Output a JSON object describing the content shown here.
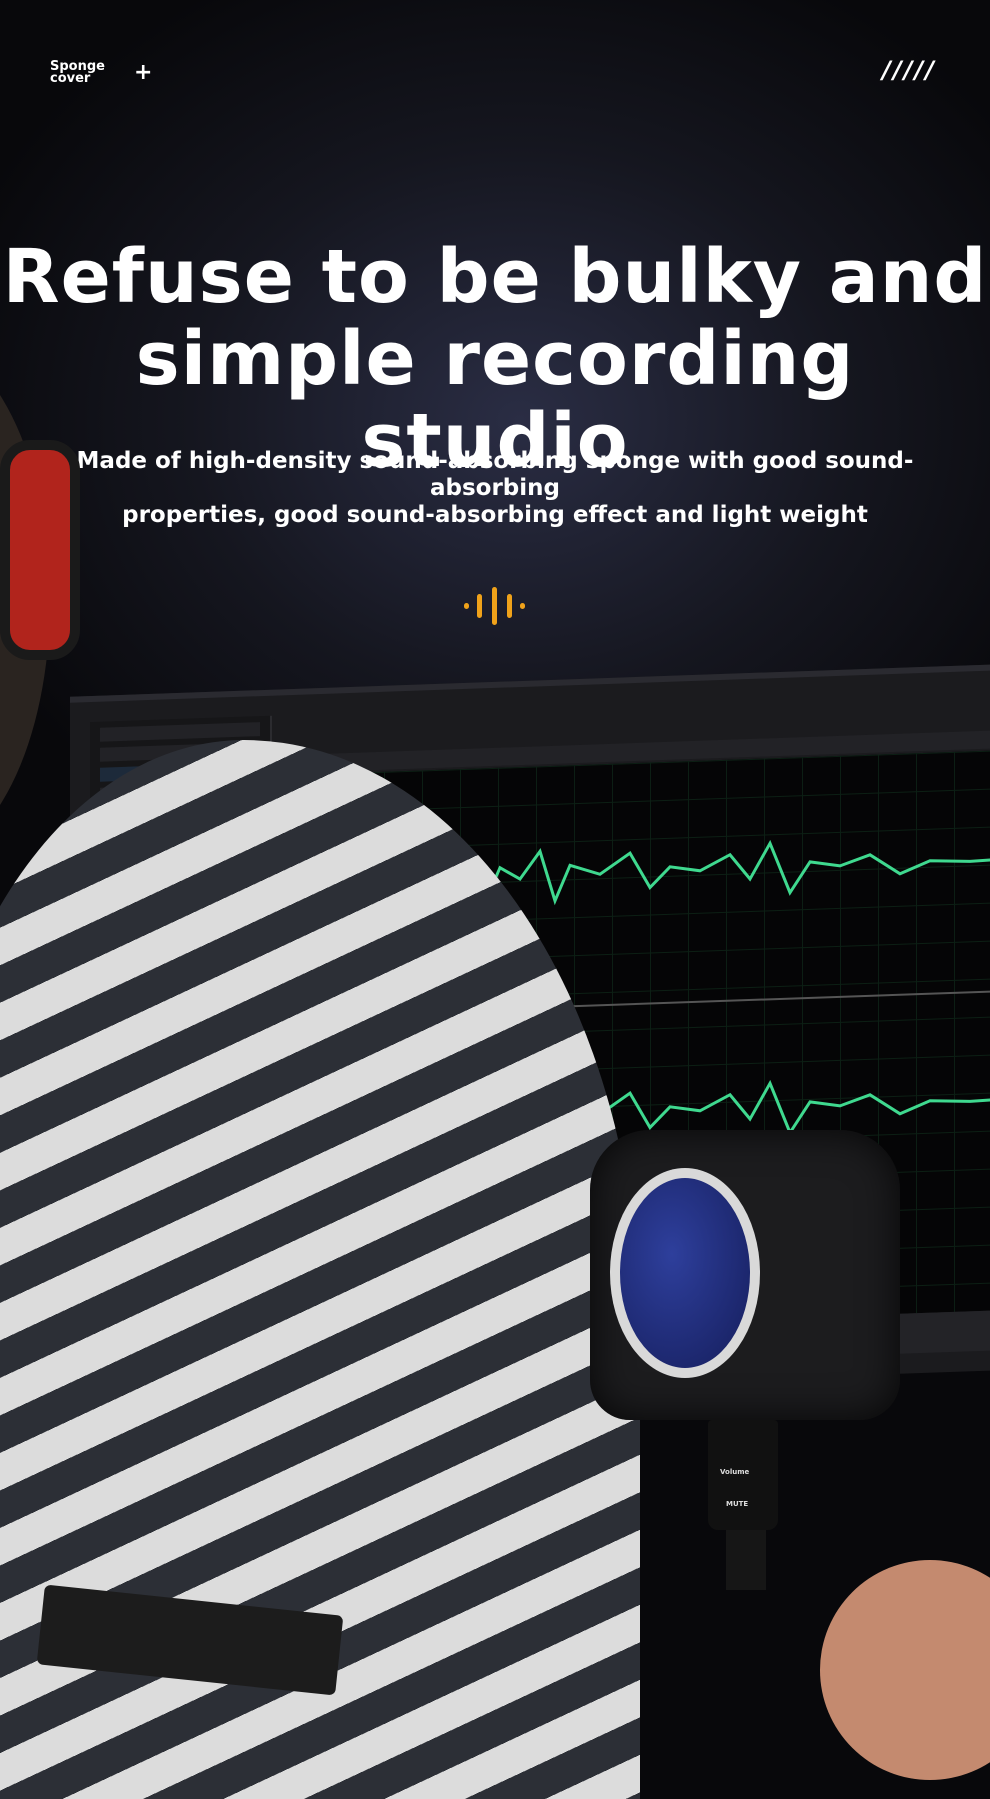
{
  "header": {
    "brand": "Sponge\ncover",
    "plus": "+",
    "menu_glyph": "/////"
  },
  "hero": {
    "title_line1": "Refuse to be bulky and",
    "title_line2": "simple recording studio",
    "subtitle_line1": "Made of high-density sound-absorbing sponge with good sound-absorbing",
    "subtitle_line2": "properties, good sound-absorbing effect and light weight"
  },
  "icons": {
    "sound_wave": "sound-wave-icon"
  },
  "colors": {
    "accent": "#f0a21a",
    "waveform": "#3fd98f",
    "sponge_blue": "#1f2b7a"
  },
  "mic": {
    "volume_label": "Volume",
    "mute_label": "MUTE"
  }
}
